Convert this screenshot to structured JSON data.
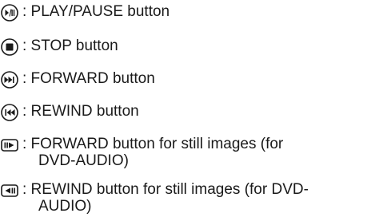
{
  "legend": {
    "items": [
      {
        "icon": "play-pause-icon",
        "text": ": PLAY/PAUSE button"
      },
      {
        "icon": "stop-icon",
        "text": ": STOP button"
      },
      {
        "icon": "forward-icon",
        "text": ": FORWARD button"
      },
      {
        "icon": "rewind-icon",
        "text": ": REWIND button"
      },
      {
        "icon": "still-forward-icon",
        "line1": ": FORWARD button for still images (for",
        "line2": "DVD-AUDIO)"
      },
      {
        "icon": "still-rewind-icon",
        "line1": ": REWIND button for still images (for DVD-",
        "line2": "AUDIO)"
      }
    ]
  }
}
